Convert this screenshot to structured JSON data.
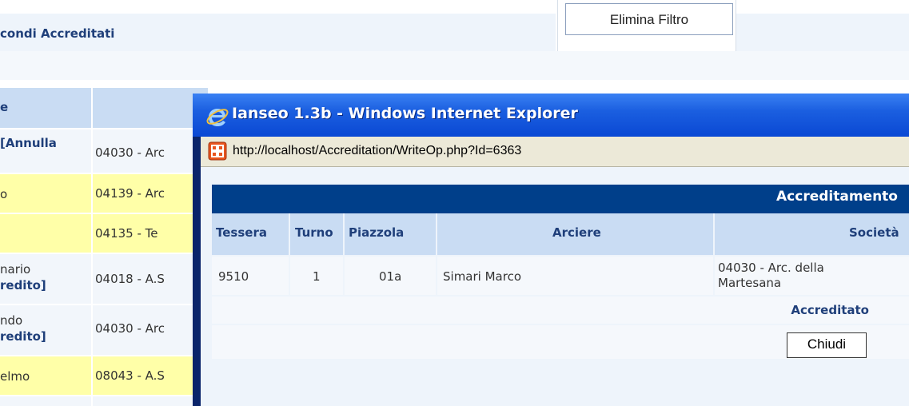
{
  "background": {
    "section_title": "condi Accreditati",
    "filter_button": "Elimina Filtro",
    "table_header": "e",
    "rows": [
      {
        "left": "[Annulla",
        "right": "04030 - Arc"
      },
      {
        "left": "o",
        "right": "04139 - Arc"
      },
      {
        "left": "",
        "right": "04135 - Te"
      },
      {
        "left_line1": "nario",
        "left_line2": "redito]",
        "right": "04018 - A.S"
      },
      {
        "left_line1": "ndo",
        "left_line2": "redito]",
        "right": "04030 - Arc"
      },
      {
        "left": "elmo",
        "right": "08043 - A.S"
      }
    ]
  },
  "popup": {
    "title": "Ianseo 1.3b - Windows Internet Explorer",
    "address": "http://localhost/Accreditation/WriteOp.php?Id=6363",
    "section_header": "Accreditamento",
    "columns": [
      "Tessera",
      "Turno",
      "Piazzola",
      "Arciere",
      "Società"
    ],
    "record": {
      "tessera": "9510",
      "turno": "1",
      "piazzola": "01a",
      "arciere": "Simari Marco",
      "societa_line1": "04030 - Arc. della",
      "societa_line2": "Martesana"
    },
    "status": "Accreditato",
    "close_button": "Chiudi"
  },
  "icons": {
    "browser": "ie-logo-icon",
    "page": "page-favicon-icon"
  },
  "colors": {
    "title_bar": "#0a48d4",
    "header_blue": "#003f8a",
    "highlight_yellow": "#ffffa8",
    "column_header": "#c9dcf3"
  }
}
